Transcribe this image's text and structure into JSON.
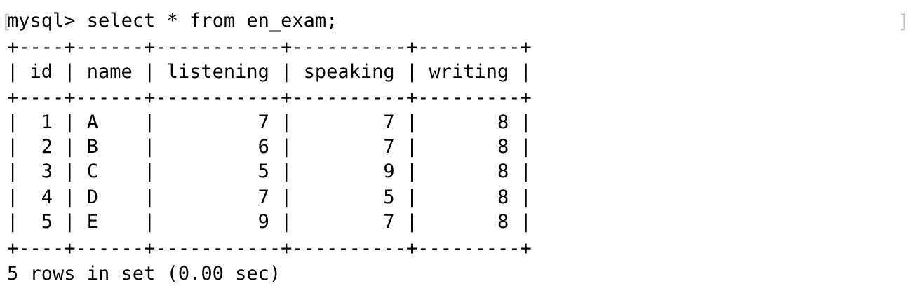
{
  "terminal": {
    "left_bracket": "[",
    "right_bracket": "]",
    "prompt": "mysql> ",
    "command": "select * from en_exam;",
    "border": "+----+------+-----------+----------+---------+",
    "header": "| id | name | listening | speaking | writing |",
    "rows": [
      "|  1 | A    |         7 |        7 |       8 |",
      "|  2 | B    |         6 |        7 |       8 |",
      "|  3 | C    |         5 |        9 |       8 |",
      "|  4 | D    |         7 |        5 |       8 |",
      "|  5 | E    |         9 |        7 |       8 |"
    ],
    "footer": "5 rows in set (0.00 sec)"
  },
  "table": {
    "columns": [
      "id",
      "name",
      "listening",
      "speaking",
      "writing"
    ],
    "records": [
      [
        "1",
        "A",
        "7",
        "7",
        "8"
      ],
      [
        "2",
        "B",
        "6",
        "7",
        "8"
      ],
      [
        "3",
        "C",
        "5",
        "9",
        "8"
      ],
      [
        "4",
        "D",
        "7",
        "5",
        "8"
      ],
      [
        "5",
        "E",
        "9",
        "7",
        "8"
      ]
    ]
  }
}
